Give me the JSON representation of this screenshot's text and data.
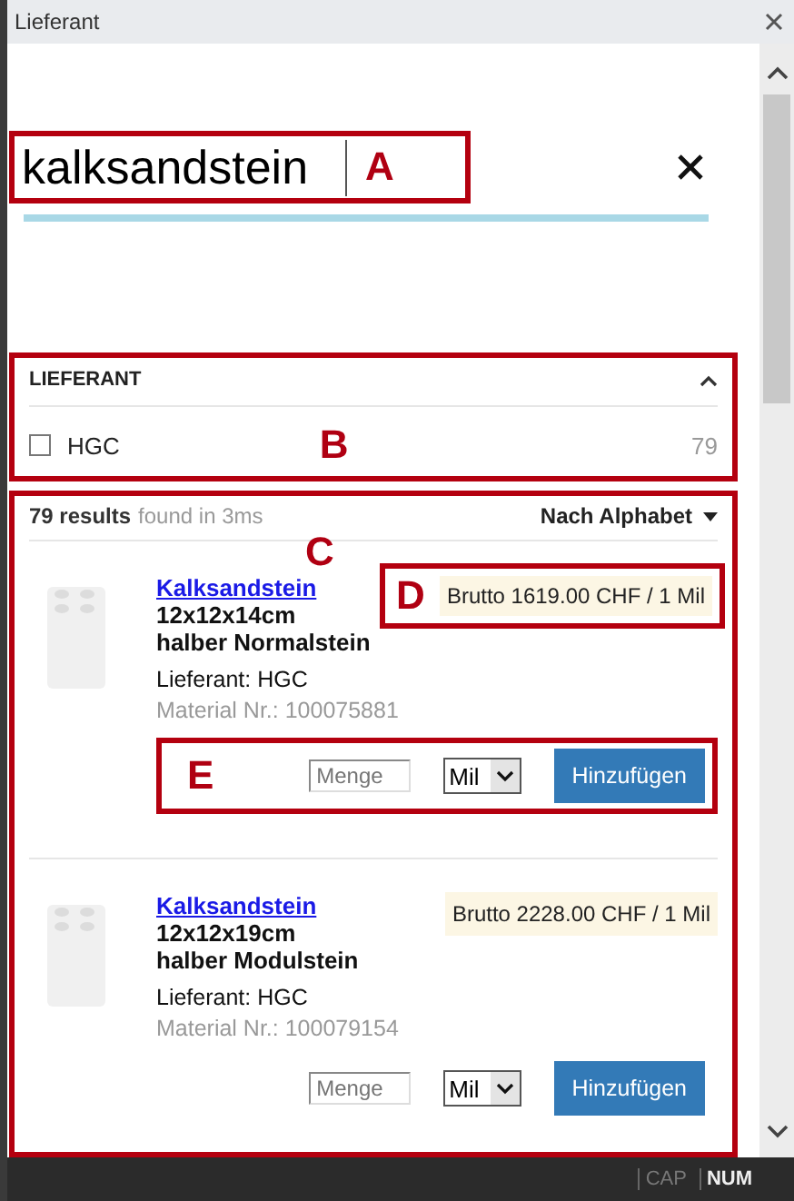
{
  "window": {
    "title": "Lieferant"
  },
  "search": {
    "value": "kalksandstein",
    "annotation": "A"
  },
  "facet": {
    "title": "LIEFERANT",
    "annotation": "B",
    "expanded": true,
    "options": [
      {
        "label": "HGC",
        "count": "79",
        "checked": false
      }
    ]
  },
  "results": {
    "count": "79 results",
    "timing": "found in 3ms",
    "sort": "Nach Alphabet",
    "annotation": "C",
    "items": [
      {
        "name": "Kalksandstein",
        "size": "12x12x14cm",
        "variant": "halber Normalstein",
        "supplier": "Lieferant: HGC",
        "material": "Material Nr.: 100075881",
        "price": "Brutto 1619.00 CHF / 1 Mil",
        "price_annotation": "D",
        "quantity_placeholder": "Menge",
        "unit": "Mil",
        "controls_annotation": "E",
        "button": "Hinzufügen"
      },
      {
        "name": "Kalksandstein",
        "size": "12x12x19cm",
        "variant": "halber Modulstein",
        "supplier": "Lieferant: HGC",
        "material": "Material Nr.: 100079154",
        "price": "Brutto 2228.00 CHF / 1 Mil",
        "quantity_placeholder": "Menge",
        "unit": "Mil",
        "button": "Hinzufügen"
      }
    ]
  },
  "status_bar": [
    {
      "label": "CAP",
      "on": false
    },
    {
      "label": "NUM",
      "on": true
    }
  ]
}
